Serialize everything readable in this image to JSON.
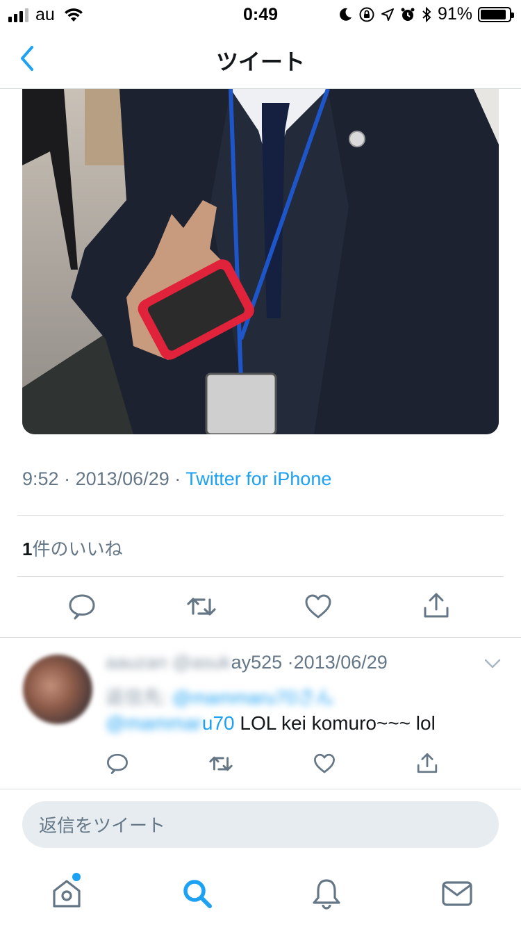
{
  "status_bar": {
    "carrier": "au",
    "time": "0:49",
    "battery_percent": "91%",
    "battery_level": 0.91,
    "icons": [
      "signal-icon",
      "wifi-icon",
      "moon-icon",
      "rotation-lock-icon",
      "location-icon",
      "alarm-icon",
      "bluetooth-icon",
      "battery-icon"
    ]
  },
  "nav": {
    "title": "ツイート",
    "back_icon": "chevron-left-icon"
  },
  "tweet": {
    "time": "9:52",
    "date": "2013/06/29",
    "separator": "·",
    "source": "Twitter for iPhone",
    "likes_count": "1",
    "likes_label": "件のいいね",
    "actions": [
      "reply-icon",
      "retweet-icon",
      "like-icon",
      "share-icon"
    ]
  },
  "reply": {
    "name": "aauzan",
    "handle": "@asukay525",
    "handle_visible": "ay525",
    "date": "2013/06/29",
    "reply_to_prefix": "返信先:",
    "reply_to_handle": "@mammaru70さん",
    "body_mention_visible": "u70",
    "body_text": " LOL kei komuro~~~ lol",
    "body_mention_hidden": "@mammar"
  },
  "compose": {
    "placeholder": "返信をツイート"
  },
  "tab_bar": {
    "items": [
      "home-icon",
      "search-icon",
      "notifications-icon",
      "messages-icon"
    ],
    "accent": "#1da1f2"
  }
}
